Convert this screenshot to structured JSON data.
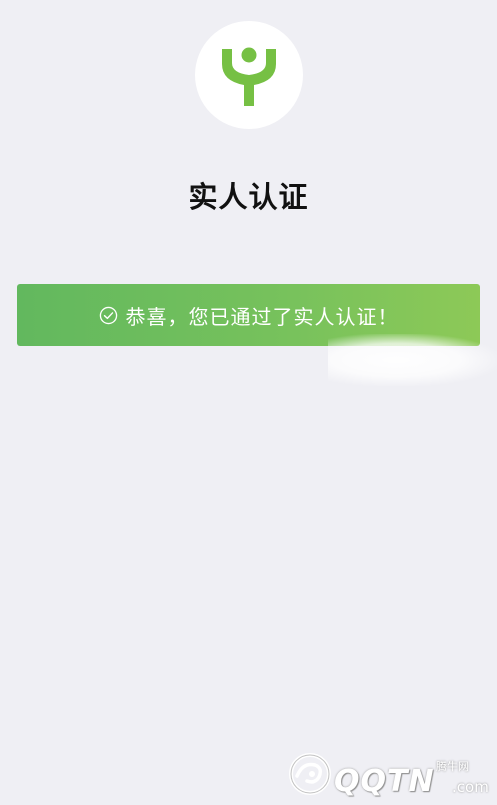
{
  "header": {
    "logo_icon": "person-arms-up-icon",
    "title": "实人认证"
  },
  "banner": {
    "icon": "check-circle-icon",
    "message": "恭喜，您已通过了实人认证！"
  },
  "watermark": {
    "brand_small": "腾牛网",
    "wordmark": "QQTN",
    "domain": ".com"
  },
  "colors": {
    "background": "#efeff4",
    "brand_green": "#76c044",
    "banner_start": "#62b85e",
    "banner_end": "#8dc957"
  }
}
